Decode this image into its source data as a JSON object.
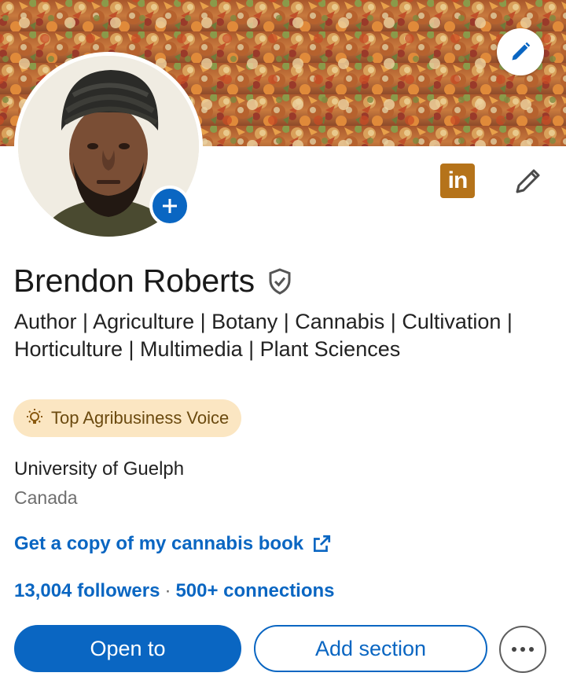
{
  "profile": {
    "name": "Brendon Roberts",
    "headline": "Author | Agriculture | Botany | Cannabis | Cultivation | Horticulture | Multimedia | Plant Sciences",
    "voice_badge": "Top Agribusiness Voice",
    "education": "University of Guelph",
    "location": "Canada",
    "link_text": "Get a copy of my cannabis book",
    "followers": "13,004 followers",
    "separator": "·",
    "connections": "500+ connections",
    "linkedin_badge": "in"
  },
  "actions": {
    "open_to": "Open to",
    "add_section": "Add section"
  },
  "icons": {
    "banner_edit": "pencil-icon",
    "avatar_add": "plus-icon",
    "linkedin": "linkedin-logo-icon",
    "header_edit": "pencil-icon",
    "verified": "shield-check-icon",
    "voice": "lightbulb-icon",
    "external_link": "external-link-icon",
    "more": "ellipsis-icon"
  },
  "colors": {
    "brand_blue": "#0a66c2",
    "linkedin_badge_bg": "#b5731a",
    "voice_badge_bg": "#fbe6c2",
    "voice_badge_text": "#6b4a0f"
  }
}
